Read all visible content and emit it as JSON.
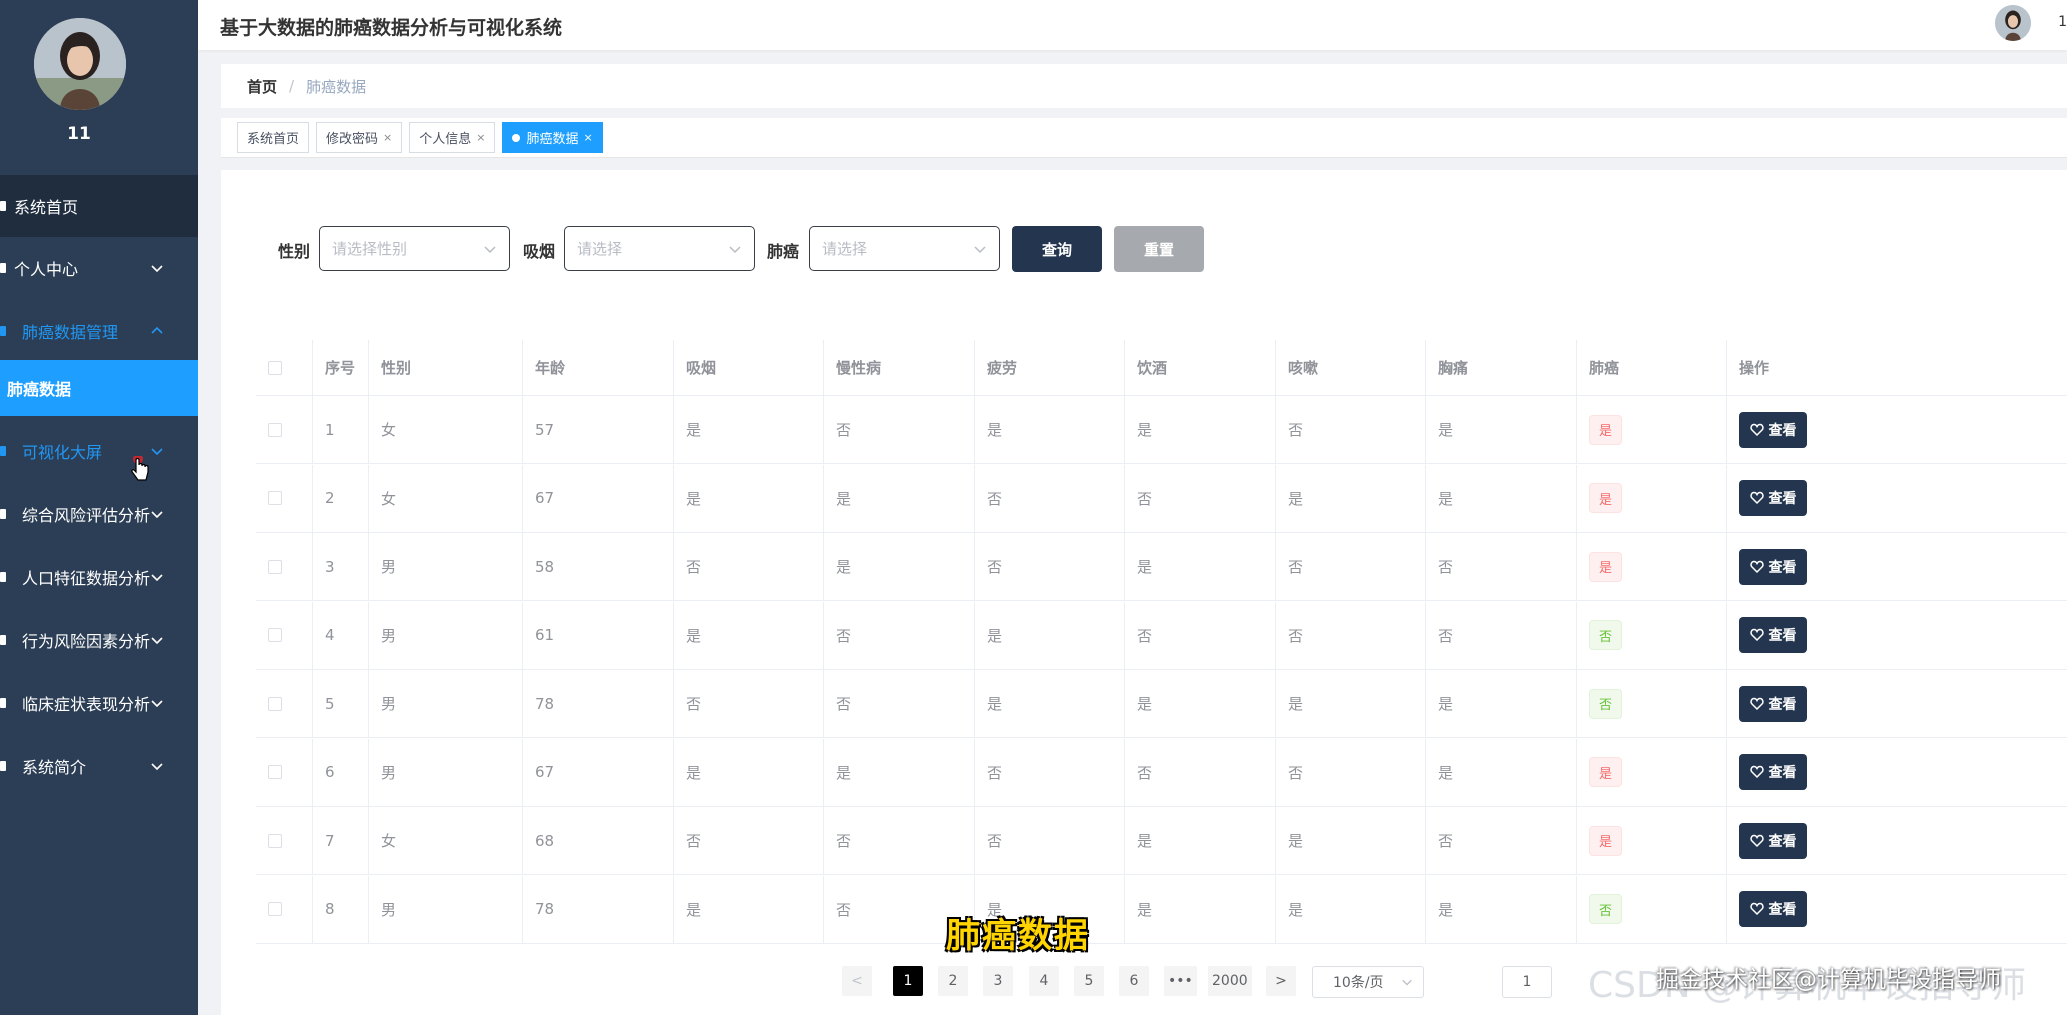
{
  "app": {
    "title": "基于大数据的肺癌数据分析与可视化系统",
    "header_user": "1"
  },
  "user": {
    "name": "11"
  },
  "sidebar": {
    "items": [
      {
        "label": "系统首页",
        "type": "home"
      },
      {
        "label": "个人中心",
        "type": "group",
        "expanded": false
      },
      {
        "label": "肺癌数据管理",
        "type": "group",
        "expanded": true
      },
      {
        "label": "肺癌数据",
        "type": "sub-active"
      },
      {
        "label": "可视化大屏",
        "type": "group-blue",
        "expanded": false
      },
      {
        "label": "综合风险评估分析",
        "type": "group",
        "expanded": false
      },
      {
        "label": "人口特征数据分析",
        "type": "group",
        "expanded": false
      },
      {
        "label": "行为风险因素分析",
        "type": "group",
        "expanded": false
      },
      {
        "label": "临床症状表现分析",
        "type": "group",
        "expanded": false
      },
      {
        "label": "系统简介",
        "type": "group",
        "expanded": false
      }
    ]
  },
  "breadcrumb": {
    "home": "首页",
    "separator": "/",
    "current": "肺癌数据"
  },
  "tabs": [
    {
      "label": "系统首页",
      "closable": false,
      "active": false
    },
    {
      "label": "修改密码",
      "closable": true,
      "active": false
    },
    {
      "label": "个人信息",
      "closable": true,
      "active": false
    },
    {
      "label": "肺癌数据",
      "closable": true,
      "active": true
    }
  ],
  "tab_close_glyph": "×",
  "filters": {
    "gender": {
      "label": "性别",
      "placeholder": "请选择性别"
    },
    "smoking": {
      "label": "吸烟",
      "placeholder": "请选择"
    },
    "lung_cancer": {
      "label": "肺癌",
      "placeholder": "请选择"
    },
    "query_label": "查询",
    "reset_label": "重置"
  },
  "table": {
    "headers": [
      "序号",
      "性别",
      "年龄",
      "吸烟",
      "慢性病",
      "疲劳",
      "饮酒",
      "咳嗽",
      "胸痛",
      "肺癌",
      "操作"
    ],
    "view_label": "查看",
    "rows": [
      [
        "1",
        "女",
        "57",
        "是",
        "否",
        "是",
        "是",
        "否",
        "是",
        "是"
      ],
      [
        "2",
        "女",
        "67",
        "是",
        "是",
        "否",
        "否",
        "是",
        "是",
        "是"
      ],
      [
        "3",
        "男",
        "58",
        "否",
        "是",
        "否",
        "是",
        "否",
        "否",
        "是"
      ],
      [
        "4",
        "男",
        "61",
        "是",
        "否",
        "是",
        "否",
        "否",
        "否",
        "否"
      ],
      [
        "5",
        "男",
        "78",
        "否",
        "否",
        "是",
        "是",
        "是",
        "是",
        "否"
      ],
      [
        "6",
        "男",
        "67",
        "是",
        "是",
        "否",
        "否",
        "否",
        "是",
        "是"
      ],
      [
        "7",
        "女",
        "68",
        "否",
        "否",
        "否",
        "是",
        "是",
        "否",
        "是"
      ],
      [
        "8",
        "男",
        "78",
        "是",
        "否",
        "是",
        "是",
        "是",
        "是",
        "否"
      ]
    ]
  },
  "pagination": {
    "prev": "<",
    "pages": [
      "1",
      "2",
      "3",
      "4",
      "5",
      "6"
    ],
    "ellipsis": "•••",
    "last": "2000",
    "next": ">",
    "page_size": "10条/页",
    "jump_value": "1"
  },
  "overlays": {
    "caption": "肺癌数据",
    "watermark": "掘金技术社区@计算机毕设指导师",
    "watermark_bg": "CSDN @计算机毕设指导师"
  },
  "colors": {
    "sidebar_bg": "#2c3e55",
    "accent": "#1e9fff",
    "primary_btn": "#24364f",
    "tag_yes": "#f56c6c",
    "tag_no": "#67c23a"
  }
}
